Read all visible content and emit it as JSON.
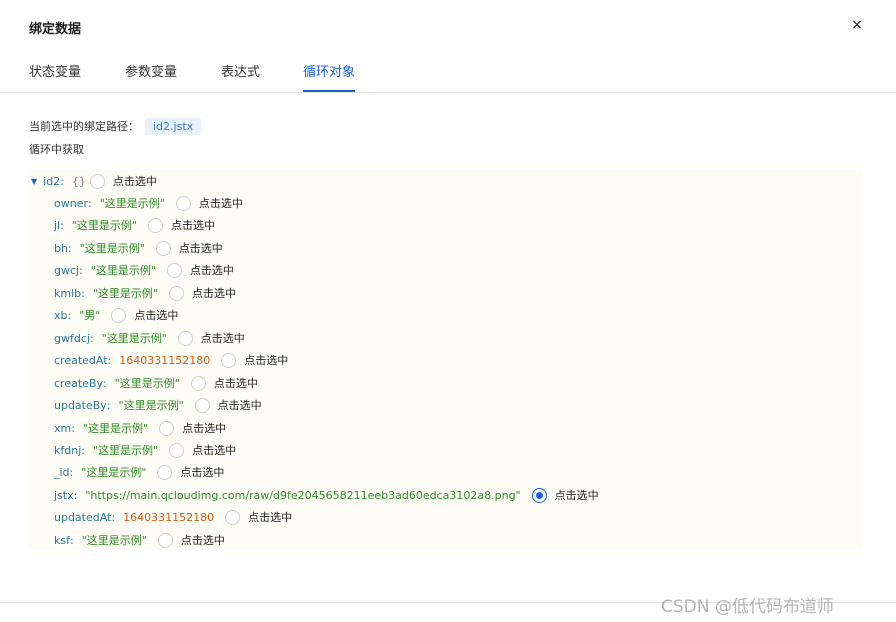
{
  "dialog": {
    "title": "绑定数据",
    "close_glyph": "×"
  },
  "tabs": [
    {
      "label": "状态变量"
    },
    {
      "label": "参数变量"
    },
    {
      "label": "表达式"
    },
    {
      "label": "循环对象"
    }
  ],
  "path": {
    "label": "当前选中的绑定路径：",
    "value": "id2.jstx"
  },
  "sub_label": "循环中获取",
  "tree": {
    "root": {
      "key": "id2",
      "value": "{}",
      "radio_label": "点击选中",
      "expanded": true
    },
    "items": [
      {
        "key": "owner",
        "value": "\"这里是示例\"",
        "type": "string",
        "radio_label": "点击选中",
        "checked": false
      },
      {
        "key": "jl",
        "value": "\"这里是示例\"",
        "type": "string",
        "radio_label": "点击选中",
        "checked": false
      },
      {
        "key": "bh",
        "value": "\"这里是示例\"",
        "type": "string",
        "radio_label": "点击选中",
        "checked": false
      },
      {
        "key": "gwcj",
        "value": "\"这里是示例\"",
        "type": "string",
        "radio_label": "点击选中",
        "checked": false
      },
      {
        "key": "kmlb",
        "value": "\"这里是示例\"",
        "type": "string",
        "radio_label": "点击选中",
        "checked": false
      },
      {
        "key": "xb",
        "value": "\"男\"",
        "type": "string",
        "radio_label": "点击选中",
        "checked": false
      },
      {
        "key": "gwfdcj",
        "value": "\"这里是示例\"",
        "type": "string",
        "radio_label": "点击选中",
        "checked": false
      },
      {
        "key": "createdAt",
        "value": "1640331152180",
        "type": "number",
        "radio_label": "点击选中",
        "checked": false
      },
      {
        "key": "createBy",
        "value": "\"这里是示例\"",
        "type": "string",
        "radio_label": "点击选中",
        "checked": false
      },
      {
        "key": "updateBy",
        "value": "\"这里是示例\"",
        "type": "string",
        "radio_label": "点击选中",
        "checked": false
      },
      {
        "key": "xm",
        "value": "\"这里是示例\"",
        "type": "string",
        "radio_label": "点击选中",
        "checked": false
      },
      {
        "key": "kfdnj",
        "value": "\"这里是示例\"",
        "type": "string",
        "radio_label": "点击选中",
        "checked": false
      },
      {
        "key": "_id",
        "value": "\"这里是示例\"",
        "type": "string",
        "radio_label": "点击选中",
        "checked": false
      },
      {
        "key": "jstx",
        "value": "\"https://main.qcloudimg.com/raw/d9fe2045658211eeb3ad60edca3102a8.png\"",
        "type": "string",
        "radio_label": "点击选中",
        "checked": true
      },
      {
        "key": "updatedAt",
        "value": "1640331152180",
        "type": "number",
        "radio_label": "点击选中",
        "checked": false
      },
      {
        "key": "ksf",
        "value": "\"这里是示例\"",
        "type": "string",
        "radio_label": "点击选中",
        "checked": false
      }
    ]
  },
  "watermark": "CSDN @低代码布道师",
  "colors": {
    "accent": "#1a62d8",
    "key": "#26779e",
    "string": "#2f8a26",
    "number": "#d35a10",
    "tree_bg": "#fdfdf6"
  }
}
